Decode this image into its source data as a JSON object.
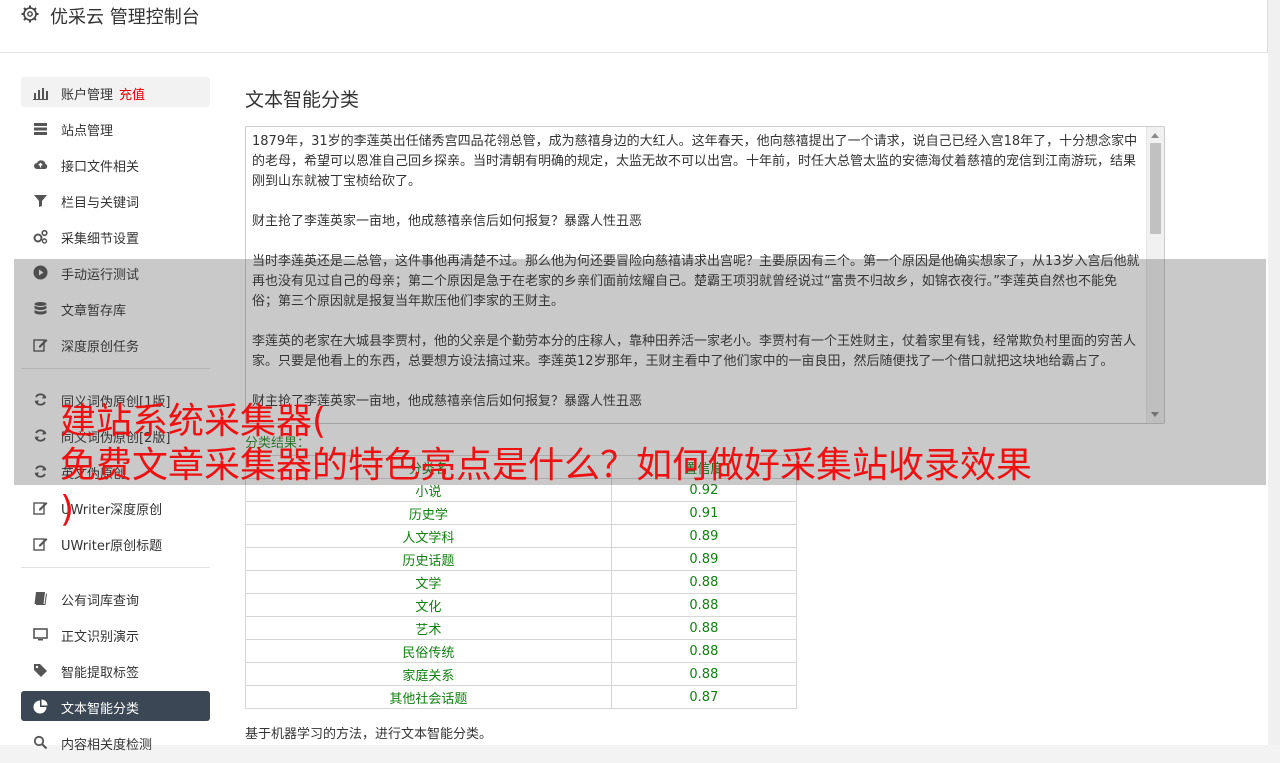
{
  "app": {
    "title": "优采云 管理控制台"
  },
  "sidebar": {
    "group1": [
      {
        "name": "account",
        "icon": "bar-chart-icon",
        "label": "账户管理",
        "extra": "充值"
      },
      {
        "name": "sites",
        "icon": "server-icon",
        "label": "站点管理"
      },
      {
        "name": "api-files",
        "icon": "cloud-upload-icon",
        "label": "接口文件相关"
      },
      {
        "name": "columns-keywords",
        "icon": "filter-icon",
        "label": "栏目与关键词"
      },
      {
        "name": "collect-settings",
        "icon": "gears-icon",
        "label": "采集细节设置"
      },
      {
        "name": "manual-run",
        "icon": "play-icon",
        "label": "手动运行测试"
      },
      {
        "name": "article-store",
        "icon": "database-icon",
        "label": "文章暂存库"
      },
      {
        "name": "deep-original",
        "icon": "edit-icon",
        "label": "深度原创任务"
      }
    ],
    "group2": [
      {
        "name": "synonym-original",
        "icon": "refresh-icon",
        "label": "同义词伪原创[1版]"
      },
      {
        "name": "synonym-original-2",
        "icon": "refresh-icon",
        "label": "同义词伪原创[2版]"
      },
      {
        "name": "synonym-original-3",
        "icon": "refresh-icon",
        "label": "英文伪原创"
      },
      {
        "name": "uwriter-deep",
        "icon": "edit-icon",
        "label": "UWriter深度原创"
      },
      {
        "name": "uwriter-title",
        "icon": "edit-icon",
        "label": "UWriter原创标题"
      }
    ],
    "group3": [
      {
        "name": "public-lexicon",
        "icon": "book-icon",
        "label": "公有词库查询"
      },
      {
        "name": "text-recognition",
        "icon": "monitor-icon",
        "label": "正文识别演示"
      },
      {
        "name": "smart-tags",
        "icon": "tag-icon",
        "label": "智能提取标签"
      },
      {
        "name": "text-classify",
        "icon": "pie-chart-icon",
        "label": "文本智能分类"
      },
      {
        "name": "content-relevance",
        "icon": "search-icon",
        "label": "内容相关度检测"
      }
    ],
    "active": "文本智能分类"
  },
  "main": {
    "title": "文本智能分类",
    "paragraphs": [
      "1879年，31岁的李莲英出任储秀宫四品花翎总管，成为慈禧身边的大红人。这年春天，他向慈禧提出了一个请求，说自己已经入宫18年了，十分想念家中的老母，希望可以恩准自己回乡探亲。当时清朝有明确的规定，太监无故不可以出宫。十年前，时任大总管太监的安德海仗着慈禧的宠信到江南游玩，结果刚到山东就被丁宝桢给砍了。",
      "财主抢了李莲英家一亩地，他成慈禧亲信后如何报复？暴露人性丑恶",
      "当时李莲英还是二总管，这件事他再清楚不过。那么他为何还要冒险向慈禧请求出宫呢？主要原因有三个。第一个原因是他确实想家了，从13岁入宫后他就再也没有见过自己的母亲；第二个原因是急于在老家的乡亲们面前炫耀自己。楚霸王项羽就曾经说过“富贵不归故乡，如锦衣夜行。”李莲英自然也不能免俗；第三个原因就是报复当年欺压他们李家的王财主。",
      "李莲英的老家在大城县李贾村，他的父亲是个勤劳本分的庄稼人，靠种田养活一家老小。李贾村有一个王姓财主，仗着家里有钱，经常欺负村里面的穷苦人家。只要是他看上的东西，总要想方设法搞过来。李莲英12岁那年，王财主看中了他们家中的一亩良田，然后随便找了一个借口就把这块地给霸占了。",
      "财主抢了李莲英家一亩地，他成慈禧亲信后如何报复？暴露人性丑恶"
    ],
    "result_label": "分类结果：",
    "table": {
      "headers": [
        "分类名",
        "置信度"
      ],
      "rows": [
        [
          "小说",
          "0.92"
        ],
        [
          "历史学",
          "0.91"
        ],
        [
          "人文学科",
          "0.89"
        ],
        [
          "历史话题",
          "0.89"
        ],
        [
          "文学",
          "0.88"
        ],
        [
          "文化",
          "0.88"
        ],
        [
          "艺术",
          "0.88"
        ],
        [
          "民俗传统",
          "0.88"
        ],
        [
          "家庭关系",
          "0.88"
        ],
        [
          "其他社会话题",
          "0.87"
        ]
      ]
    },
    "footnote": "基于机器学习的方法，进行文本智能分类。"
  },
  "overlay": {
    "line1": "建站系统采集器(",
    "line2": "免费文章采集器的特色亮点是什么？如何做好采集站收录效果",
    "line3": ")"
  },
  "colors": {
    "active_nav_bg": "#3b4754",
    "hot_text": "#e60000",
    "result_green": "#118011",
    "banner_red": "#ee1111"
  }
}
